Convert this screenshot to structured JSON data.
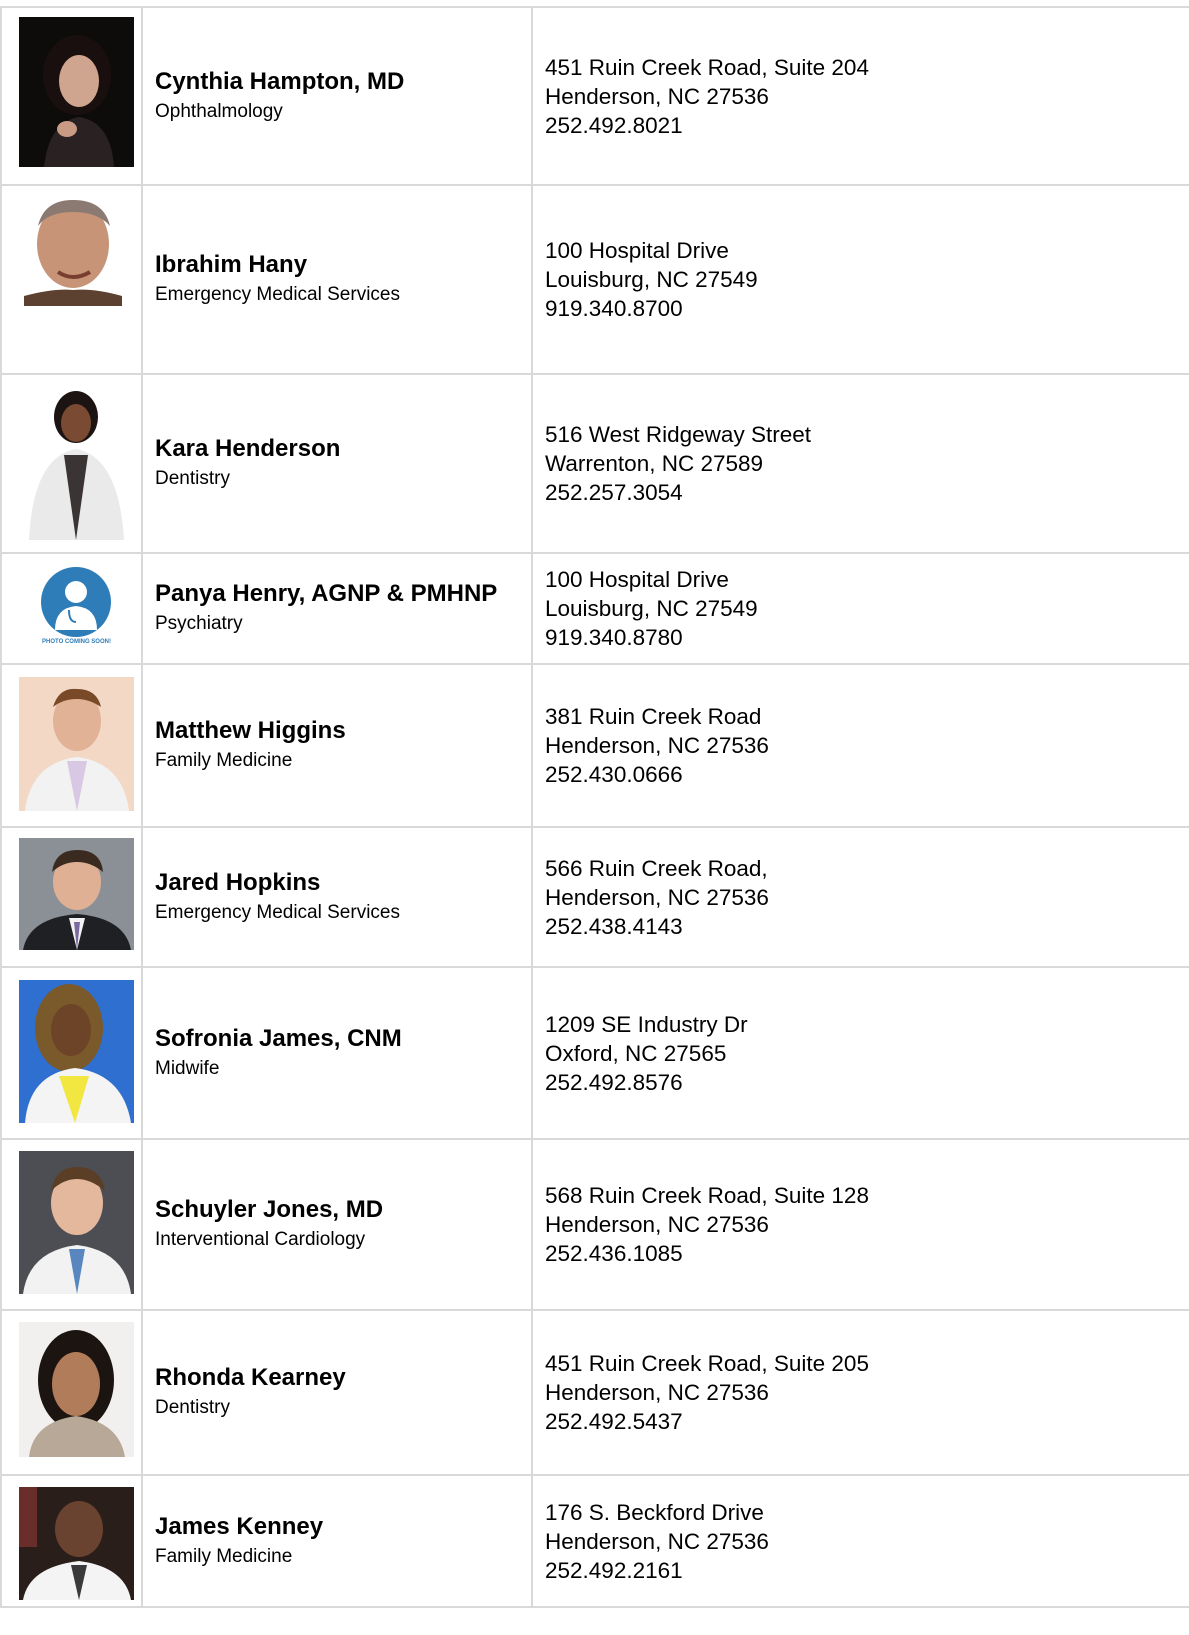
{
  "providers": [
    {
      "name": "Cynthia Hampton, MD",
      "specialty": "Ophthalmology",
      "address1": "451 Ruin Creek Road, Suite 204",
      "address2": "Henderson, NC 27536",
      "phone": "252.492.8021",
      "photo": "portrait-woman-dark-hair"
    },
    {
      "name": "Ibrahim Hany",
      "specialty": "Emergency Medical Services",
      "address1": "100 Hospital Drive",
      "address2": "Louisburg, NC 27549",
      "phone": "919.340.8700",
      "photo": "portrait-man"
    },
    {
      "name": "Kara Henderson",
      "specialty": "Dentistry",
      "address1": "516 West Ridgeway Street",
      "address2": "Warrenton, NC 27589",
      "phone": "252.257.3054",
      "photo": "portrait-woman-white-coat"
    },
    {
      "name": "Panya Henry, AGNP & PMHNP",
      "specialty": "Psychiatry",
      "address1": "100 Hospital Drive",
      "address2": "Louisburg, NC 27549",
      "phone": "919.340.8780",
      "photo": "placeholder-doctor-icon",
      "photo_caption": "PHOTO COMING SOON!"
    },
    {
      "name": "Matthew Higgins",
      "specialty": "Family Medicine",
      "address1": "381 Ruin Creek Road",
      "address2": "Henderson, NC 27536",
      "phone": "252.430.0666",
      "photo": "portrait-man-white-coat"
    },
    {
      "name": "Jared Hopkins",
      "specialty": "Emergency Medical Services",
      "address1": "566 Ruin Creek Road,",
      "address2": "Henderson, NC 27536",
      "phone": "252.438.4143",
      "photo": "portrait-man-suit"
    },
    {
      "name": "Sofronia James, CNM",
      "specialty": "Midwife",
      "address1": "1209 SE Industry Dr",
      "address2": "Oxford, NC 27565",
      "phone": "252.492.8576",
      "photo": "portrait-woman-braids"
    },
    {
      "name": "Schuyler Jones, MD",
      "specialty": "Interventional Cardiology",
      "address1": "568 Ruin Creek Road, Suite 128",
      "address2": "Henderson, NC 27536",
      "phone": "252.436.1085",
      "photo": "portrait-man-white-coat"
    },
    {
      "name": "Rhonda Kearney",
      "specialty": "Dentistry",
      "address1": "451 Ruin Creek Road, Suite 205",
      "address2": "Henderson, NC 27536",
      "phone": "252.492.5437",
      "photo": "portrait-woman"
    },
    {
      "name": "James Kenney",
      "specialty": "Family Medicine",
      "address1": "176 S. Beckford Drive",
      "address2": "Henderson, NC 27536",
      "phone": "252.492.2161",
      "photo": "portrait-man-white-coat"
    }
  ],
  "colors": {
    "grid_line": "#d9d9d9",
    "placeholder_blue": "#2f7db8"
  }
}
